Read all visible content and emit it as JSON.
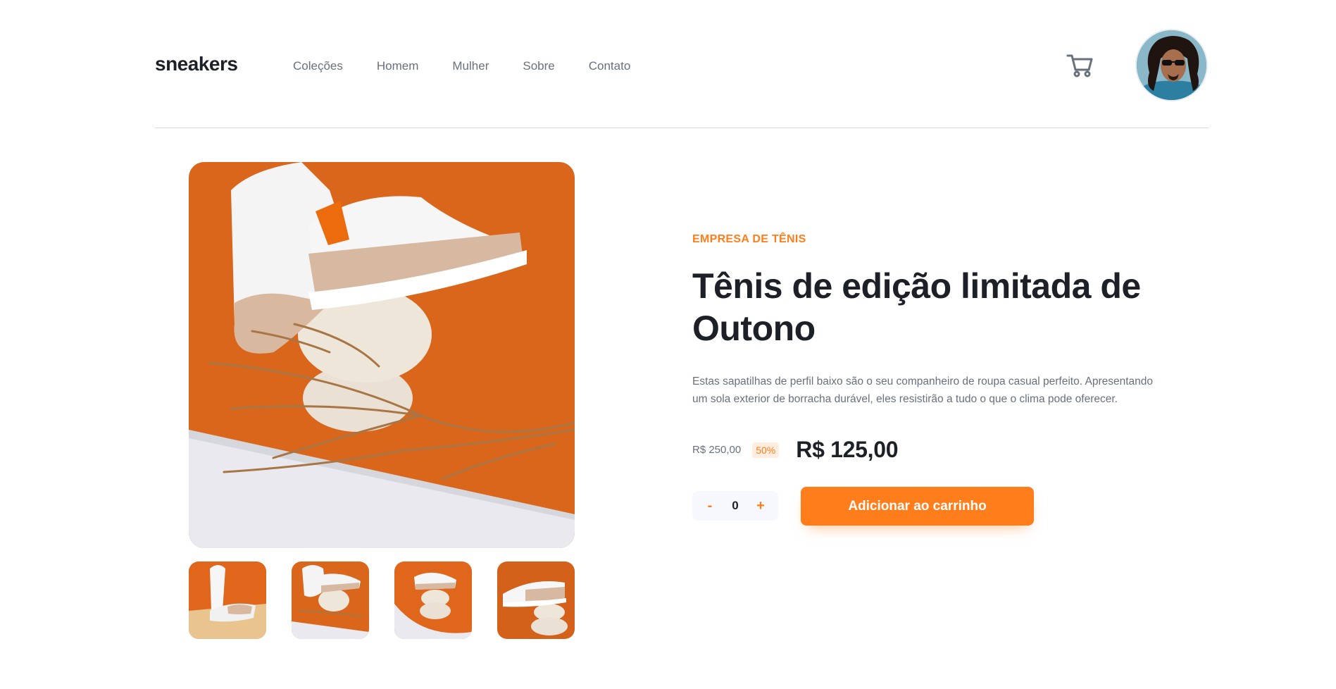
{
  "brand": {
    "logo": "sneakers"
  },
  "nav": {
    "items": [
      "Coleções",
      "Homem",
      "Mulher",
      "Sobre",
      "Contato"
    ]
  },
  "icons": {
    "cart": "cart-icon",
    "avatar": "user-avatar"
  },
  "product": {
    "company": "EMPRESA DE TÊNIS",
    "title": "Tênis de edição limitada de Outono",
    "description": "Estas sapatilhas de perfil baixo são o seu companheiro de roupa casual perfeito. Apresentando um sola exterior de borracha durável, eles resistirão a tudo o que o clima pode oferecer.",
    "old_price": "R$ 250,00",
    "discount": "50%",
    "price": "R$ 125,00"
  },
  "cart_controls": {
    "minus": "-",
    "quantity": "0",
    "plus": "+",
    "add_label": "Adicionar ao carrinho"
  },
  "colors": {
    "accent": "#ff7e1b",
    "accent_pale": "#ffede0",
    "dark": "#1d2026",
    "gray": "#69707d"
  }
}
